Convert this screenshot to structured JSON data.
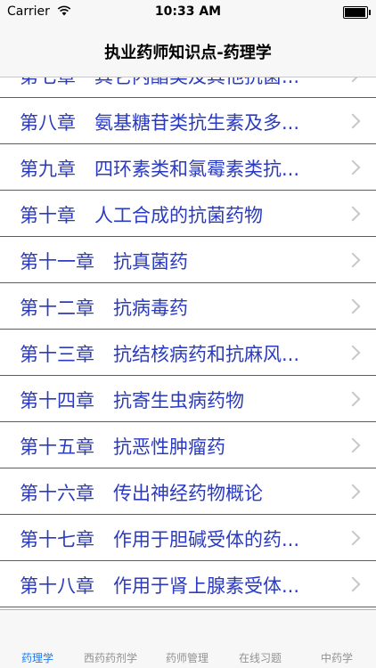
{
  "status_bar": {
    "carrier": "Carrier",
    "time": "10:33 AM"
  },
  "nav": {
    "title": "执业药师知识点-药理学"
  },
  "list": {
    "items": [
      {
        "label": "第七章　其它内酯类及其他抗菌..."
      },
      {
        "label": "第八章　氨基糖苷类抗生素及多..."
      },
      {
        "label": "第九章　四环素类和氯霉素类抗..."
      },
      {
        "label": "第十章　人工合成的抗菌药物"
      },
      {
        "label": "第十一章　抗真菌药"
      },
      {
        "label": "第十二章　抗病毒药"
      },
      {
        "label": "第十三章　抗结核病药和抗麻风..."
      },
      {
        "label": "第十四章　抗寄生虫病药物"
      },
      {
        "label": "第十五章　抗恶性肿瘤药"
      },
      {
        "label": "第十六章　传出神经药物概论"
      },
      {
        "label": "第十七章　作用于胆碱受体的药..."
      },
      {
        "label": "第十八章　作用于肾上腺素受体..."
      }
    ]
  },
  "tabs": [
    {
      "label": "药理学"
    },
    {
      "label": "西药药剂学"
    },
    {
      "label": "药师管理"
    },
    {
      "label": "在线习题"
    },
    {
      "label": "中药学"
    }
  ],
  "colors": {
    "accent": "#1b7af5",
    "row_text": "#2b3bbf",
    "separator": "#4b4fd6"
  }
}
